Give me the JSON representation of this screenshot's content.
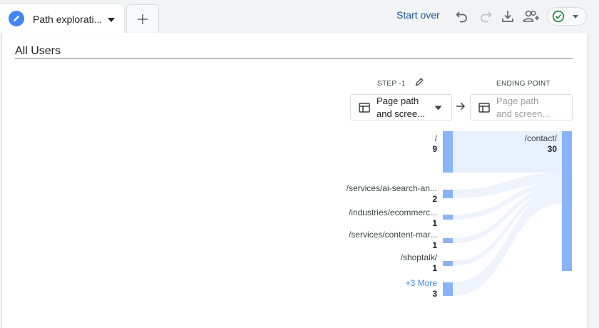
{
  "tab": {
    "label": "Path explorati..."
  },
  "toolbar": {
    "start_over": "Start over"
  },
  "segment": {
    "title": "All Users"
  },
  "steps": {
    "step_label": "STEP -1",
    "ending_label": "ENDING POINT",
    "step_dimension": {
      "line1": "Page path",
      "line2": "and scree..."
    },
    "ending_dimension": {
      "line1": "Page path",
      "line2": "and screen..."
    }
  },
  "nodes": [
    {
      "label": "/",
      "count": "9",
      "value": 9
    },
    {
      "label": "/services/ai-search-an...",
      "count": "2",
      "value": 2
    },
    {
      "label": "/industries/ecommerc...",
      "count": "1",
      "value": 1
    },
    {
      "label": "/services/content-mar...",
      "count": "1",
      "value": 1
    },
    {
      "label": "/shoptalk/",
      "count": "1",
      "value": 1
    }
  ],
  "more_node": {
    "label": "+3 More",
    "count": "3",
    "value": 3
  },
  "ending_node": {
    "label": "/contact/",
    "count": "30",
    "value": 30
  },
  "colors": {
    "node": "#8ab4f8",
    "flow": "#e8f0fe",
    "accent": "#4285f4",
    "link": "#1a56a6"
  },
  "icons": [
    "pencil-icon",
    "chevron-down-icon",
    "plus-icon",
    "undo-icon",
    "redo-icon",
    "download-icon",
    "share-user-icon",
    "check-circle-icon",
    "arrow-right-icon",
    "table-icon"
  ]
}
